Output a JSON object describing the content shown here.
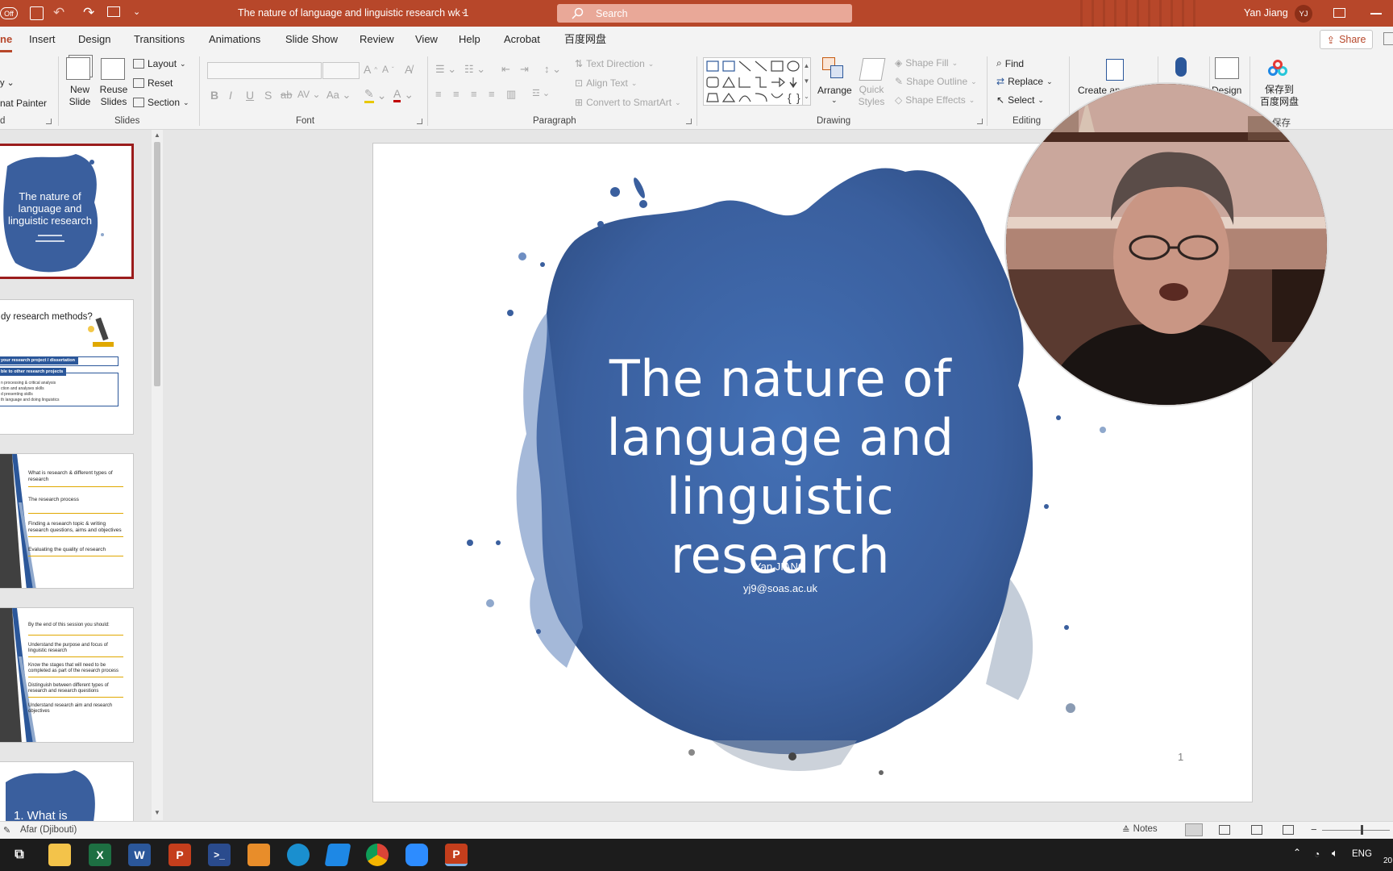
{
  "titlebar": {
    "autosave": "Off",
    "doc_title": "The nature of language and linguistic research wk 1",
    "search_placeholder": "Search",
    "user_name": "Yan Jiang",
    "user_initials": "YJ"
  },
  "tabs": [
    "ne",
    "Insert",
    "Design",
    "Transitions",
    "Animations",
    "Slide Show",
    "Review",
    "View",
    "Help",
    "Acrobat",
    "百度网盘"
  ],
  "share_label": "Share",
  "ribbon": {
    "clipboard": {
      "format_painter": "nat Painter",
      "group": "d"
    },
    "slides": {
      "new_slide": "New\nSlide",
      "reuse_slides": "Reuse\nSlides",
      "layout": "Layout",
      "reset": "Reset",
      "section": "Section",
      "group": "Slides"
    },
    "font": {
      "group": "Font"
    },
    "paragraph": {
      "text_direction": "Text Direction",
      "align_text": "Align Text",
      "convert_smartart": "Convert to SmartArt",
      "group": "Paragraph"
    },
    "drawing": {
      "arrange": "Arrange",
      "quick_styles": "Quick\nStyles",
      "shape_fill": "Shape Fill",
      "shape_outline": "Shape Outline",
      "shape_effects": "Shape Effects",
      "group": "Drawing"
    },
    "editing": {
      "find": "Find",
      "replace": "Replace",
      "select": "Select",
      "group": "Editing"
    },
    "adobe": {
      "create": "Create an"
    },
    "designer": {
      "design": "Design"
    },
    "baidu": {
      "save_to": "保存到\n百度网盘",
      "group": "保存"
    }
  },
  "thumbnails": {
    "t1_title": "The nature of language and linguistic research",
    "t2_title": "dy research methods?",
    "t2_box1": "your research project / dissertation",
    "t2_box2": "ble to other research projects",
    "t2_lines": [
      "n processing & critical analysis",
      "ction and analyses skills",
      "d presenting skills",
      "th language and doing linguistics"
    ],
    "t3_items": [
      "What is research & different types of research",
      "The research process",
      "Finding a research topic & writing research questions, aims and objectives",
      "Evaluating the quality of research"
    ],
    "t4_items": [
      "By the end of this session you should:",
      "Understand the purpose and focus of linguistic research",
      "Know the stages that will need to be completed as part of the research process",
      "Distinguish between different types of research and research questions",
      "Understand research aim and research objectives"
    ],
    "t5_title": "1. What is"
  },
  "slide": {
    "title": "The nature of language and linguistic research",
    "author": "Yan JIANG",
    "email": "yj9@soas.ac.uk",
    "number": "1"
  },
  "statusbar": {
    "language": "Afar (Djibouti)",
    "notes": "Notes"
  },
  "taskbar": {
    "lang": "ENG",
    "time": "20"
  },
  "colors": {
    "accent": "#b7472a",
    "slide_blue": "#3a5f9e"
  }
}
